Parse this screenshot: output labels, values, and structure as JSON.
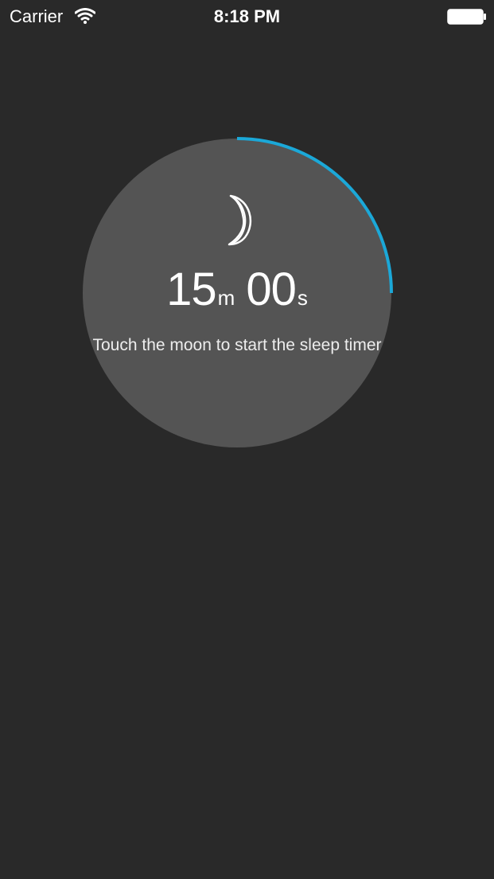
{
  "status_bar": {
    "carrier": "Carrier",
    "time": "8:18 PM",
    "wifi_icon": "wifi-icon",
    "battery_icon": "battery-icon"
  },
  "timer": {
    "minutes": "15",
    "minutes_unit": "m",
    "seconds": "00",
    "seconds_unit": "s",
    "progress_fraction": 0.25,
    "moon_icon": "moon-icon",
    "hint": "Touch the moon to start the sleep timer"
  },
  "colors": {
    "background": "#292929",
    "circle": "#545454",
    "accent": "#1BA8D8",
    "text": "#FFFFFF"
  }
}
